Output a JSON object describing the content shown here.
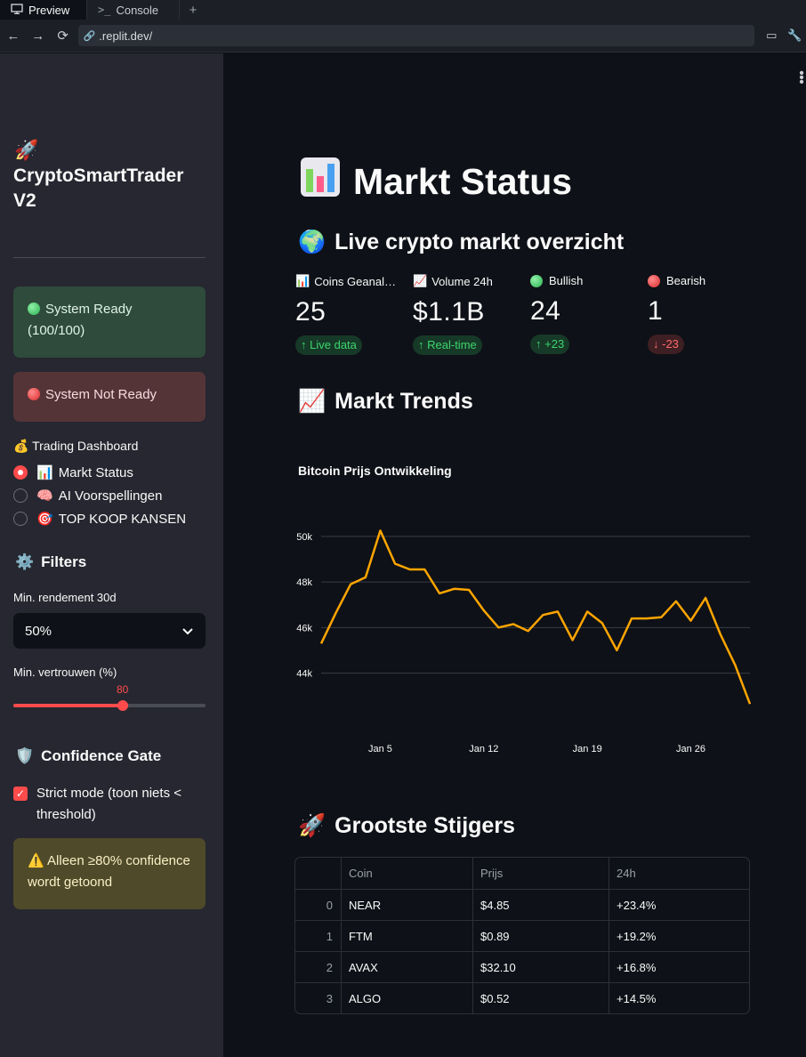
{
  "browser": {
    "tabs": [
      {
        "label": "Preview",
        "icon": "monitor-icon"
      },
      {
        "label": "Console",
        "icon": "terminal-icon"
      }
    ],
    "url": ".replit.dev/"
  },
  "sidebar": {
    "app_title": "CryptoSmartTrader V2",
    "status_ready": "System Ready (100/100)",
    "status_not_ready": "System Not Ready",
    "nav_section_label": "Trading Dashboard",
    "nav_items": [
      {
        "label": "Markt Status",
        "selected": true
      },
      {
        "label": "AI Voorspellingen",
        "selected": false
      },
      {
        "label": "TOP KOOP KANSEN",
        "selected": false
      }
    ],
    "filters_title": "Filters",
    "min_return_label": "Min. rendement 30d",
    "min_return_value": "50%",
    "min_confidence_label": "Min. vertrouwen (%)",
    "min_confidence_value": "80",
    "min_confidence_fraction": 0.8,
    "confidence_gate_title": "Confidence Gate",
    "strict_mode_label": "Strict mode (toon niets < threshold)",
    "strict_mode_checked": true,
    "warning_text": "Alleen ≥80% confidence wordt getoond"
  },
  "main": {
    "title": "Markt Status",
    "overview_title": "Live crypto markt overzicht",
    "metrics": [
      {
        "label": "Coins Geanal…",
        "value": "25",
        "delta": "Live data",
        "direction": "up"
      },
      {
        "label": "Volume 24h",
        "value": "$1.1B",
        "delta": "Real-time",
        "direction": "up"
      },
      {
        "label": "Bullish",
        "value": "24",
        "delta": "+23",
        "direction": "up"
      },
      {
        "label": "Bearish",
        "value": "1",
        "delta": "-23",
        "direction": "down"
      }
    ],
    "trends_title": "Markt Trends",
    "gainers_title": "Grootste Stijgers",
    "table": {
      "headers": [
        "",
        "Coin",
        "Prijs",
        "24h"
      ],
      "rows": [
        [
          "0",
          "NEAR",
          "$4.85",
          "+23.4%"
        ],
        [
          "1",
          "FTM",
          "$0.89",
          "+19.2%"
        ],
        [
          "2",
          "AVAX",
          "$32.10",
          "+16.8%"
        ],
        [
          "3",
          "ALGO",
          "$0.52",
          "+14.5%"
        ]
      ]
    }
  },
  "chart_data": {
    "type": "line",
    "title": "Bitcoin Prijs Ontwikkeling",
    "x": [
      "2025-01-01",
      "2025-01-02",
      "2025-01-03",
      "2025-01-04",
      "2025-01-05",
      "2025-01-06",
      "2025-01-07",
      "2025-01-08",
      "2025-01-09",
      "2025-01-10",
      "2025-01-11",
      "2025-01-12",
      "2025-01-13",
      "2025-01-14",
      "2025-01-15",
      "2025-01-16",
      "2025-01-17",
      "2025-01-18",
      "2025-01-19",
      "2025-01-20",
      "2025-01-21",
      "2025-01-22",
      "2025-01-23",
      "2025-01-24",
      "2025-01-25",
      "2025-01-26",
      "2025-01-27",
      "2025-01-28",
      "2025-01-29",
      "2025-01-30"
    ],
    "values": [
      45300,
      46650,
      47900,
      48200,
      50250,
      48800,
      48550,
      48550,
      47500,
      47700,
      47650,
      46750,
      46000,
      46150,
      45850,
      46550,
      46700,
      45450,
      46700,
      46200,
      45000,
      46400,
      46400,
      46450,
      47150,
      46300,
      47300,
      45700,
      44350,
      42650
    ],
    "ylim": [
      42500,
      50500
    ],
    "yticks": [
      44000,
      46000,
      48000,
      50000
    ],
    "ytick_labels": [
      "44k",
      "46k",
      "48k",
      "50k"
    ],
    "xtick_labels": [
      "Jan 5",
      "Jan 12",
      "Jan 19",
      "Jan 26"
    ],
    "xtick_year": "2025",
    "color": "#ffa500",
    "grid": true
  }
}
